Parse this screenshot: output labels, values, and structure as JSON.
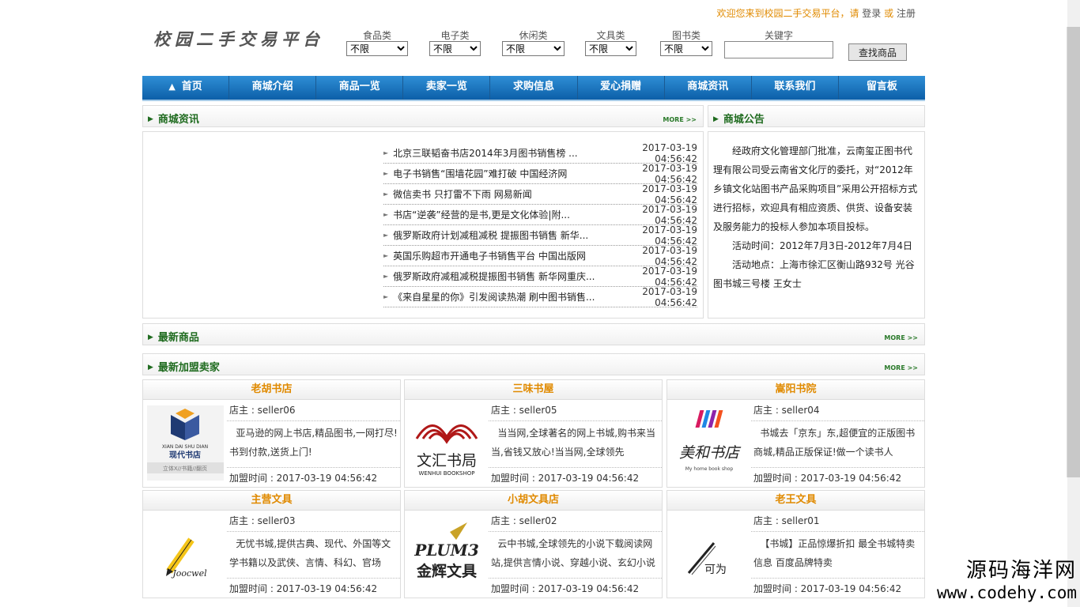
{
  "header": {
    "welcome_prefix": "欢迎您来到校园二手交易平台，请",
    "login": "登录",
    "or": "或",
    "register": "注册",
    "logo": "校园二手交易平台"
  },
  "search": {
    "food_label": "食品类",
    "elec_label": "电子类",
    "leisure_label": "休闲类",
    "stationery_label": "文具类",
    "books_label": "图书类",
    "keyword_label": "关键字",
    "unlimited": "不限",
    "button": "查找商品"
  },
  "nav": {
    "home": "首页",
    "intro": "商城介绍",
    "products": "商品一览",
    "sellers": "卖家一览",
    "wanted": "求购信息",
    "donate": "爱心捐赠",
    "news": "商城资讯",
    "contact": "联系我们",
    "board": "留言板"
  },
  "sections": {
    "news_title": "商城资讯",
    "notice_title": "商城公告",
    "latest_title": "最新商品",
    "sellers_title": "最新加盟卖家",
    "more": "MORE >>"
  },
  "news": [
    {
      "title": "北京三联韬奋书店2014年3月图书销售榜 ...",
      "date": "2017-03-19 04:56:42"
    },
    {
      "title": "电子书销售“围墙花园”难打破 中国经济网",
      "date": "2017-03-19 04:56:42"
    },
    {
      "title": "微信卖书 只打雷不下雨 网易新闻",
      "date": "2017-03-19 04:56:42"
    },
    {
      "title": "书店“逆袭”经营的是书,更是文化体验|附...",
      "date": "2017-03-19 04:56:42"
    },
    {
      "title": "俄罗斯政府计划减租减税 提振图书销售 新华...",
      "date": "2017-03-19 04:56:42"
    },
    {
      "title": "英国乐购超市开通电子书销售平台 中国出版网",
      "date": "2017-03-19 04:56:42"
    },
    {
      "title": "俄罗斯政府减租减税提振图书销售 新华网重庆...",
      "date": "2017-03-19 04:56:42"
    },
    {
      "title": "《来自星星的你》引发阅读热潮 刷中图书销售...",
      "date": "2017-03-19 04:56:42"
    }
  ],
  "notice": {
    "p1": "经政府文化管理部门批准，云南玺正图书代理有限公司受云南省文化厅的委托，对“2012年乡镇文化站图书产品采购项目”采用公开招标方式进行招标，欢迎具有相应资质、供货、设备安装及服务能力的投标人参加本项目投标。",
    "p2": "活动时间：2012年7月3日-2012年7月4日",
    "p3": "活动地点：上海市徐汇区衡山路932号 光谷图书城三号楼 王女士"
  },
  "sellers": [
    {
      "name": "老胡书店",
      "owner": "店主 : seller06",
      "desc": "亚马逊的网上书店,精品图书,一网打尽!书到付款,送货上门!",
      "time": "加盟时间 : 2017-03-19 04:56:42",
      "logo_text": "现代书店",
      "logo_sub": "XIAN DAI SHU DIAN",
      "logo_foot": "立体X//书籍//翻页"
    },
    {
      "name": "三味书屋",
      "owner": "店主 : seller05",
      "desc": "当当网,全球著名的网上书城,购书来当当,省钱又放心!当当网,全球领先",
      "time": "加盟时间 : 2017-03-19 04:56:42",
      "logo_text": "文汇书局",
      "logo_sub": "WENHUI BOOKSHOP"
    },
    {
      "name": "嵩阳书院",
      "owner": "店主 : seller04",
      "desc": "书城去「京东」东,超便宜的正版图书商城,精品正版保证!做一个读书人",
      "time": "加盟时间 : 2017-03-19 04:56:42",
      "logo_text": "美和书店",
      "logo_sub": "My home book shop"
    },
    {
      "name": "主营文具",
      "owner": "店主 : seller03",
      "desc": "无忧书城,提供古典、现代、外国等文学书籍以及武侠、言情、科幻、官场",
      "time": "加盟时间 : 2017-03-19 04:56:42",
      "logo_text": "Joocwel"
    },
    {
      "name": "小胡文具店",
      "owner": "店主 : seller02",
      "desc": "云中书城,全球领先的小说下载阅读网站,提供言情小说、穿越小说、玄幻小说",
      "time": "加盟时间 : 2017-03-19 04:56:42",
      "logo_text": "金辉文具",
      "logo_sub": "PLUM3"
    },
    {
      "name": "老王文具",
      "owner": "店主 : seller01",
      "desc": "【书城】正品惊爆折扣 最全书城特卖信息 百度品牌特卖",
      "time": "加盟时间 : 2017-03-19 04:56:42",
      "logo_text": "可为"
    }
  ],
  "watermark": {
    "line1": "源码海洋网",
    "line2": "www.codehy.com"
  }
}
